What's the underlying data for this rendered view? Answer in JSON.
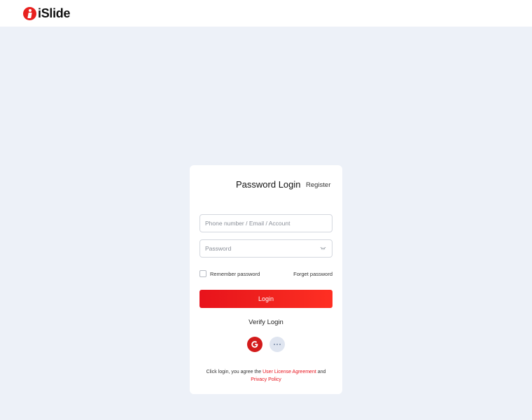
{
  "header": {
    "logo_text": "iSlide"
  },
  "login": {
    "title": "Password Login",
    "register_label": "Register",
    "account_placeholder": "Phone number / Email / Account",
    "password_placeholder": "Password",
    "remember_label": "Remember password",
    "forget_label": "Forget password",
    "login_button": "Login",
    "verify_label": "Verify Login",
    "more_label": "···",
    "agreement_prefix": "Click login, you agree the",
    "license_link": "User License Agreement",
    "and_text": "and",
    "privacy_link": "Privacy Policy"
  },
  "icons": {
    "logo": "islide-logo-icon",
    "password_toggle": "eye-closed-icon",
    "social_google": "google-icon",
    "social_more": "more-icon"
  },
  "colors": {
    "accent": "#e8131c",
    "background": "#edf1f8",
    "card": "#ffffff"
  }
}
